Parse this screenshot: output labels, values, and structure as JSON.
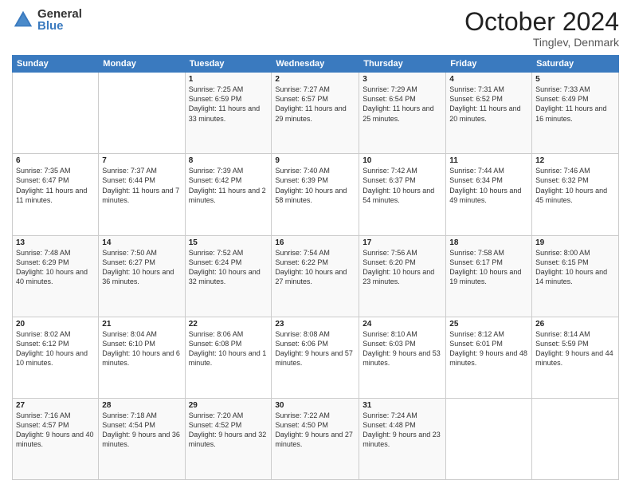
{
  "header": {
    "logo_general": "General",
    "logo_blue": "Blue",
    "month_title": "October 2024",
    "subtitle": "Tinglev, Denmark"
  },
  "days_of_week": [
    "Sunday",
    "Monday",
    "Tuesday",
    "Wednesday",
    "Thursday",
    "Friday",
    "Saturday"
  ],
  "weeks": [
    [
      {
        "day": "",
        "sunrise": "",
        "sunset": "",
        "daylight": ""
      },
      {
        "day": "",
        "sunrise": "",
        "sunset": "",
        "daylight": ""
      },
      {
        "day": "1",
        "sunrise": "Sunrise: 7:25 AM",
        "sunset": "Sunset: 6:59 PM",
        "daylight": "Daylight: 11 hours and 33 minutes."
      },
      {
        "day": "2",
        "sunrise": "Sunrise: 7:27 AM",
        "sunset": "Sunset: 6:57 PM",
        "daylight": "Daylight: 11 hours and 29 minutes."
      },
      {
        "day": "3",
        "sunrise": "Sunrise: 7:29 AM",
        "sunset": "Sunset: 6:54 PM",
        "daylight": "Daylight: 11 hours and 25 minutes."
      },
      {
        "day": "4",
        "sunrise": "Sunrise: 7:31 AM",
        "sunset": "Sunset: 6:52 PM",
        "daylight": "Daylight: 11 hours and 20 minutes."
      },
      {
        "day": "5",
        "sunrise": "Sunrise: 7:33 AM",
        "sunset": "Sunset: 6:49 PM",
        "daylight": "Daylight: 11 hours and 16 minutes."
      }
    ],
    [
      {
        "day": "6",
        "sunrise": "Sunrise: 7:35 AM",
        "sunset": "Sunset: 6:47 PM",
        "daylight": "Daylight: 11 hours and 11 minutes."
      },
      {
        "day": "7",
        "sunrise": "Sunrise: 7:37 AM",
        "sunset": "Sunset: 6:44 PM",
        "daylight": "Daylight: 11 hours and 7 minutes."
      },
      {
        "day": "8",
        "sunrise": "Sunrise: 7:39 AM",
        "sunset": "Sunset: 6:42 PM",
        "daylight": "Daylight: 11 hours and 2 minutes."
      },
      {
        "day": "9",
        "sunrise": "Sunrise: 7:40 AM",
        "sunset": "Sunset: 6:39 PM",
        "daylight": "Daylight: 10 hours and 58 minutes."
      },
      {
        "day": "10",
        "sunrise": "Sunrise: 7:42 AM",
        "sunset": "Sunset: 6:37 PM",
        "daylight": "Daylight: 10 hours and 54 minutes."
      },
      {
        "day": "11",
        "sunrise": "Sunrise: 7:44 AM",
        "sunset": "Sunset: 6:34 PM",
        "daylight": "Daylight: 10 hours and 49 minutes."
      },
      {
        "day": "12",
        "sunrise": "Sunrise: 7:46 AM",
        "sunset": "Sunset: 6:32 PM",
        "daylight": "Daylight: 10 hours and 45 minutes."
      }
    ],
    [
      {
        "day": "13",
        "sunrise": "Sunrise: 7:48 AM",
        "sunset": "Sunset: 6:29 PM",
        "daylight": "Daylight: 10 hours and 40 minutes."
      },
      {
        "day": "14",
        "sunrise": "Sunrise: 7:50 AM",
        "sunset": "Sunset: 6:27 PM",
        "daylight": "Daylight: 10 hours and 36 minutes."
      },
      {
        "day": "15",
        "sunrise": "Sunrise: 7:52 AM",
        "sunset": "Sunset: 6:24 PM",
        "daylight": "Daylight: 10 hours and 32 minutes."
      },
      {
        "day": "16",
        "sunrise": "Sunrise: 7:54 AM",
        "sunset": "Sunset: 6:22 PM",
        "daylight": "Daylight: 10 hours and 27 minutes."
      },
      {
        "day": "17",
        "sunrise": "Sunrise: 7:56 AM",
        "sunset": "Sunset: 6:20 PM",
        "daylight": "Daylight: 10 hours and 23 minutes."
      },
      {
        "day": "18",
        "sunrise": "Sunrise: 7:58 AM",
        "sunset": "Sunset: 6:17 PM",
        "daylight": "Daylight: 10 hours and 19 minutes."
      },
      {
        "day": "19",
        "sunrise": "Sunrise: 8:00 AM",
        "sunset": "Sunset: 6:15 PM",
        "daylight": "Daylight: 10 hours and 14 minutes."
      }
    ],
    [
      {
        "day": "20",
        "sunrise": "Sunrise: 8:02 AM",
        "sunset": "Sunset: 6:12 PM",
        "daylight": "Daylight: 10 hours and 10 minutes."
      },
      {
        "day": "21",
        "sunrise": "Sunrise: 8:04 AM",
        "sunset": "Sunset: 6:10 PM",
        "daylight": "Daylight: 10 hours and 6 minutes."
      },
      {
        "day": "22",
        "sunrise": "Sunrise: 8:06 AM",
        "sunset": "Sunset: 6:08 PM",
        "daylight": "Daylight: 10 hours and 1 minute."
      },
      {
        "day": "23",
        "sunrise": "Sunrise: 8:08 AM",
        "sunset": "Sunset: 6:06 PM",
        "daylight": "Daylight: 9 hours and 57 minutes."
      },
      {
        "day": "24",
        "sunrise": "Sunrise: 8:10 AM",
        "sunset": "Sunset: 6:03 PM",
        "daylight": "Daylight: 9 hours and 53 minutes."
      },
      {
        "day": "25",
        "sunrise": "Sunrise: 8:12 AM",
        "sunset": "Sunset: 6:01 PM",
        "daylight": "Daylight: 9 hours and 48 minutes."
      },
      {
        "day": "26",
        "sunrise": "Sunrise: 8:14 AM",
        "sunset": "Sunset: 5:59 PM",
        "daylight": "Daylight: 9 hours and 44 minutes."
      }
    ],
    [
      {
        "day": "27",
        "sunrise": "Sunrise: 7:16 AM",
        "sunset": "Sunset: 4:57 PM",
        "daylight": "Daylight: 9 hours and 40 minutes."
      },
      {
        "day": "28",
        "sunrise": "Sunrise: 7:18 AM",
        "sunset": "Sunset: 4:54 PM",
        "daylight": "Daylight: 9 hours and 36 minutes."
      },
      {
        "day": "29",
        "sunrise": "Sunrise: 7:20 AM",
        "sunset": "Sunset: 4:52 PM",
        "daylight": "Daylight: 9 hours and 32 minutes."
      },
      {
        "day": "30",
        "sunrise": "Sunrise: 7:22 AM",
        "sunset": "Sunset: 4:50 PM",
        "daylight": "Daylight: 9 hours and 27 minutes."
      },
      {
        "day": "31",
        "sunrise": "Sunrise: 7:24 AM",
        "sunset": "Sunset: 4:48 PM",
        "daylight": "Daylight: 9 hours and 23 minutes."
      },
      {
        "day": "",
        "sunrise": "",
        "sunset": "",
        "daylight": ""
      },
      {
        "day": "",
        "sunrise": "",
        "sunset": "",
        "daylight": ""
      }
    ]
  ]
}
